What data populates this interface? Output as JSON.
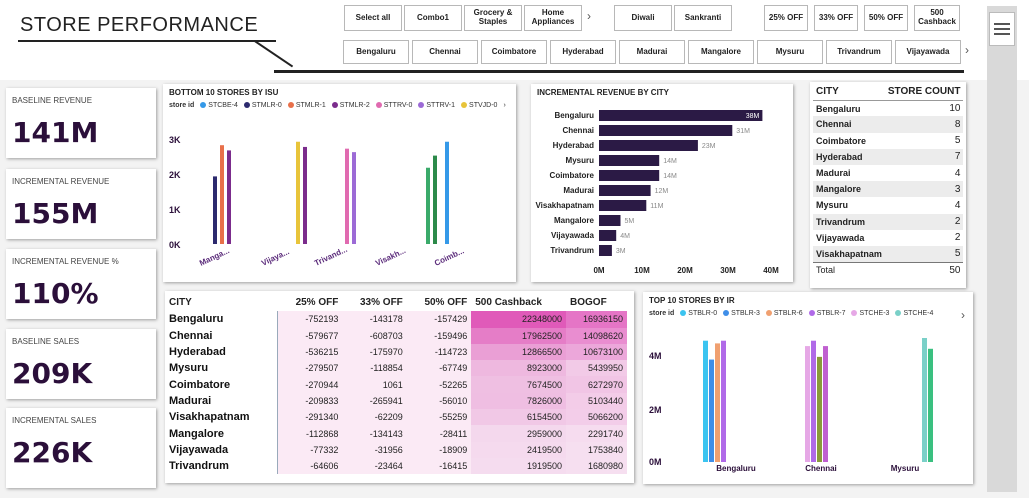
{
  "header": {
    "title": "STORE PERFORMANCE"
  },
  "slicers": {
    "promos": [
      "Select all",
      "Combo1",
      "Grocery & Staples",
      "Home Appliances"
    ],
    "festivals": [
      "Diwali",
      "Sankranti"
    ],
    "offers": [
      "25% OFF",
      "33% OFF",
      "50% OFF",
      "500 Cashback"
    ],
    "cities": [
      "Bengaluru",
      "Chennai",
      "Coimbatore",
      "Hyderabad",
      "Madurai",
      "Mangalore",
      "Mysuru",
      "Trivandrum",
      "Vijayawada"
    ],
    "chevron": "›"
  },
  "kpis": [
    {
      "label": "BASELINE REVENUE",
      "value": "141M"
    },
    {
      "label": "INCREMENTAL REVENUE",
      "value": "155M"
    },
    {
      "label": "INCREMENTAL REVENUE %",
      "value": "110%"
    },
    {
      "label": "BASELINE SALES",
      "value": "209K"
    },
    {
      "label": "INCREMENTAL SALES",
      "value": "226K"
    }
  ],
  "bottom10": {
    "title": "BOTTOM 10 STORES BY ISU",
    "legend_label": "store id",
    "legend": [
      {
        "name": "STCBE-4",
        "color": "#3599e8"
      },
      {
        "name": "STMLR-0",
        "color": "#2c2a6e"
      },
      {
        "name": "STMLR-1",
        "color": "#e8704a"
      },
      {
        "name": "STMLR-2",
        "color": "#7b2c8c"
      },
      {
        "name": "STTRV-0",
        "color": "#e06ab0"
      },
      {
        "name": "STTRV-1",
        "color": "#9c6ad6"
      },
      {
        "name": "STVJD-0",
        "color": "#e8c43a"
      }
    ],
    "yticks": [
      "3K",
      "2K",
      "1K",
      "0K"
    ],
    "xlabels": [
      "Manga...",
      "Vijaya...",
      "Trivand...",
      "Visakh...",
      "Coimb..."
    ]
  },
  "increv": {
    "title": "INCREMENTAL REVENUE BY CITY",
    "xticks": [
      "0M",
      "10M",
      "20M",
      "30M",
      "40M"
    ]
  },
  "storecount": {
    "headers": [
      "CITY",
      "STORE COUNT"
    ],
    "rows": [
      [
        "Bengaluru",
        "10"
      ],
      [
        "Chennai",
        "8"
      ],
      [
        "Coimbatore",
        "5"
      ],
      [
        "Hyderabad",
        "7"
      ],
      [
        "Madurai",
        "4"
      ],
      [
        "Mangalore",
        "3"
      ],
      [
        "Mysuru",
        "4"
      ],
      [
        "Trivandrum",
        "2"
      ],
      [
        "Vijayawada",
        "2"
      ],
      [
        "Visakhapatnam",
        "5"
      ]
    ],
    "total": [
      "Total",
      "50"
    ]
  },
  "irtable": {
    "headers": [
      "CITY",
      "25% OFF",
      "33% OFF",
      "50% OFF",
      "500 Cashback",
      "BOGOF"
    ],
    "rows": [
      [
        "Bengaluru",
        "-752193",
        "-143178",
        "-157429",
        "22348000",
        "16936150"
      ],
      [
        "Chennai",
        "-579677",
        "-608703",
        "-159496",
        "17962500",
        "14098620"
      ],
      [
        "Hyderabad",
        "-536215",
        "-175970",
        "-114723",
        "12866500",
        "10673100"
      ],
      [
        "Mysuru",
        "-279507",
        "-118854",
        "-67749",
        "8923000",
        "5439950"
      ],
      [
        "Coimbatore",
        "-270944",
        "1061",
        "-52265",
        "7674500",
        "6272970"
      ],
      [
        "Madurai",
        "-209833",
        "-265941",
        "-56010",
        "7826000",
        "5103440"
      ],
      [
        "Visakhapatnam",
        "-291340",
        "-62209",
        "-55259",
        "6154500",
        "5066200"
      ],
      [
        "Mangalore",
        "-112868",
        "-134143",
        "-28411",
        "2959000",
        "2291740"
      ],
      [
        "Vijayawada",
        "-77332",
        "-31956",
        "-18909",
        "2419500",
        "1753840"
      ],
      [
        "Trivandrum",
        "-64606",
        "-23464",
        "-16415",
        "1919500",
        "1680980"
      ]
    ]
  },
  "top10": {
    "title": "TOP 10 STORES BY IR",
    "legend_label": "store id",
    "legend": [
      {
        "name": "STBLR-0",
        "color": "#3bc4f0"
      },
      {
        "name": "STBLR-3",
        "color": "#3f8ee8"
      },
      {
        "name": "STBLR-6",
        "color": "#f0a070"
      },
      {
        "name": "STBLR-7",
        "color": "#b06ae8"
      },
      {
        "name": "STCHE-3",
        "color": "#e6a8e6"
      },
      {
        "name": "STCHE-4",
        "color": "#7ad0c8"
      }
    ],
    "yticks": [
      "4M",
      "2M",
      "0M"
    ],
    "xlabels": [
      "Bengaluru",
      "Chennai",
      "Mysuru"
    ]
  },
  "chart_data": [
    {
      "type": "bar",
      "title": "BOTTOM 10 STORES BY ISU",
      "categories": [
        "Manga...",
        "Vijaya...",
        "Trivand...",
        "Visakh...",
        "Coimb..."
      ],
      "ylim": [
        0,
        3000
      ],
      "grid": false,
      "legend_placement": "top",
      "bars": [
        {
          "category": 0,
          "color": "#2c2a6e",
          "value": 1950
        },
        {
          "category": 0,
          "color": "#e8704a",
          "value": 2850
        },
        {
          "category": 0,
          "color": "#7b2c8c",
          "value": 2700
        },
        {
          "category": 1,
          "color": "#e8c43a",
          "value": 2950
        },
        {
          "category": 1,
          "color": "#7b2c8c",
          "value": 2800
        },
        {
          "category": 2,
          "color": "#e06ab0",
          "value": 2750
        },
        {
          "category": 2,
          "color": "#9c6ad6",
          "value": 2650
        },
        {
          "category": 3,
          "color": "#3aaa6a",
          "value": 2200
        },
        {
          "category": 3,
          "color": "#2c8a4a",
          "value": 2550
        },
        {
          "category": 4,
          "color": "#3599e8",
          "value": 2950
        }
      ]
    },
    {
      "type": "bar",
      "orientation": "horizontal",
      "title": "INCREMENTAL REVENUE BY CITY",
      "categories": [
        "Bengaluru",
        "Chennai",
        "Hyderabad",
        "Mysuru",
        "Coimbatore",
        "Madurai",
        "Visakhapatnam",
        "Mangalore",
        "Vijayawada",
        "Trivandrum"
      ],
      "values": [
        38,
        31,
        23,
        14,
        14,
        12,
        11,
        5,
        4,
        3
      ],
      "data_labels": [
        "38M",
        "31M",
        "23M",
        "14M",
        "14M",
        "12M",
        "11M",
        "5M",
        "4M",
        "3M"
      ],
      "xlim": [
        0,
        40
      ],
      "color": "#2b1a45",
      "grid": false
    },
    {
      "type": "bar",
      "title": "TOP 10 STORES BY IR",
      "categories": [
        "Bengaluru",
        "Chennai",
        "Mysuru"
      ],
      "ylim": [
        0,
        4.6
      ],
      "grid": false,
      "legend_placement": "top",
      "bars": [
        {
          "category": 0,
          "color": "#3bc4f0",
          "value": 4.5
        },
        {
          "category": 0,
          "color": "#3f8ee8",
          "value": 3.8
        },
        {
          "category": 0,
          "color": "#f0a070",
          "value": 4.4
        },
        {
          "category": 0,
          "color": "#b06ae8",
          "value": 4.5
        },
        {
          "category": 1,
          "color": "#e6a8e6",
          "value": 4.3
        },
        {
          "category": 1,
          "color": "#b06ae8",
          "value": 4.5
        },
        {
          "category": 1,
          "color": "#8a9a3a",
          "value": 3.9
        },
        {
          "category": 1,
          "color": "#c060d0",
          "value": 4.3
        },
        {
          "category": 2,
          "color": "#7ad0c8",
          "value": 4.6
        },
        {
          "category": 2,
          "color": "#3ac080",
          "value": 4.2
        }
      ]
    }
  ]
}
